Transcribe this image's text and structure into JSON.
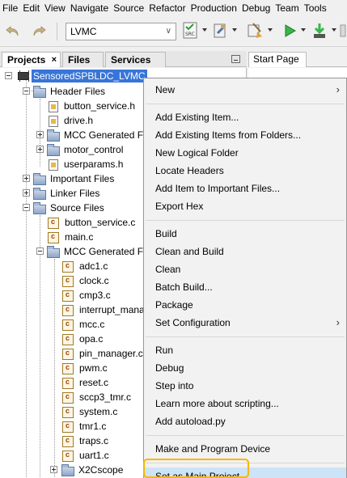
{
  "menubar": [
    "File",
    "Edit",
    "View",
    "Navigate",
    "Source",
    "Refactor",
    "Production",
    "Debug",
    "Team",
    "Tools"
  ],
  "toolbar": {
    "config_value": "LVMC",
    "icons": [
      "undo-icon",
      "redo-icon",
      "config-dropdown",
      "source-config-icon",
      "build-icon",
      "run-icon",
      "program-device-icon"
    ]
  },
  "panel": {
    "tabs": [
      {
        "label": "Projects",
        "active": true,
        "closable": true
      },
      {
        "label": "Files",
        "active": false,
        "closable": false
      },
      {
        "label": "Services",
        "active": false,
        "closable": false
      }
    ],
    "editor_tab": "Start Page"
  },
  "tree": {
    "project": "SensoredSPBLDC_LVMC",
    "header_files": {
      "label": "Header Files",
      "children": [
        "button_service.h",
        "drive.h",
        "MCC Generated Files",
        "motor_control",
        "userparams.h"
      ]
    },
    "important_files": "Important Files",
    "linker_files": "Linker Files",
    "source_files": {
      "label": "Source Files",
      "children": [
        "button_service.c",
        "main.c"
      ],
      "mcc": {
        "label": "MCC Generated Files",
        "children": [
          "adc1.c",
          "clock.c",
          "cmp3.c",
          "interrupt_manager.c",
          "mcc.c",
          "opa.c",
          "pin_manager.c",
          "pwm.c",
          "reset.c",
          "sccp3_tmr.c",
          "system.c",
          "tmr1.c",
          "traps.c",
          "uart1.c"
        ],
        "x2cscope": "X2Cscope"
      }
    }
  },
  "context_menu": {
    "groups": [
      [
        {
          "label": "New",
          "submenu": true
        }
      ],
      [
        {
          "label": "Add Existing Item..."
        },
        {
          "label": "Add Existing Items from Folders..."
        },
        {
          "label": "New Logical Folder"
        },
        {
          "label": "Locate Headers"
        },
        {
          "label": "Add Item to Important Files..."
        },
        {
          "label": "Export Hex"
        }
      ],
      [
        {
          "label": "Build"
        },
        {
          "label": "Clean and Build"
        },
        {
          "label": "Clean"
        },
        {
          "label": "Batch Build..."
        },
        {
          "label": "Package"
        },
        {
          "label": "Set Configuration",
          "submenu": true
        }
      ],
      [
        {
          "label": "Run"
        },
        {
          "label": "Debug"
        },
        {
          "label": "Step into"
        },
        {
          "label": "Learn more about scripting..."
        },
        {
          "label": "Add autoload.py"
        }
      ],
      [
        {
          "label": "Make and Program Device"
        }
      ],
      [
        {
          "label": "Set as Main Project",
          "highlighted": true
        }
      ]
    ]
  },
  "colors": {
    "selection": "#3875d7",
    "highlight_ring": "#f5b800",
    "menu_bg": "#f2f2f2"
  }
}
